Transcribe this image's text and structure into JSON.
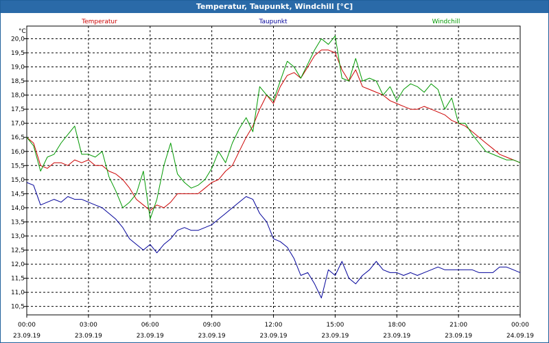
{
  "window": {
    "title": "Temperatur, Taupunkt, Windchill [°C]"
  },
  "chart_data": {
    "type": "line",
    "title": "Temperatur, Taupunkt, Windchill [°C]",
    "y_unit": "°C",
    "ylim": [
      10.2,
      20.45
    ],
    "yticks": [
      10.5,
      11.0,
      11.5,
      12.0,
      12.5,
      13.0,
      13.5,
      14.0,
      14.5,
      15.0,
      15.5,
      16.0,
      16.5,
      17.0,
      17.5,
      18.0,
      18.5,
      19.0,
      19.5,
      20.0
    ],
    "ytick_labels": [
      "10,5",
      "11,0",
      "11,5",
      "12,0",
      "12,5",
      "13,0",
      "13,5",
      "14,0",
      "14,5",
      "15,0",
      "15,5",
      "16,0",
      "16,5",
      "17,0",
      "17,5",
      "18,0",
      "18,5",
      "19,0",
      "19,5",
      "20,0"
    ],
    "xlim": [
      0,
      24
    ],
    "xticks": [
      0,
      3,
      6,
      9,
      12,
      15,
      18,
      21,
      24
    ],
    "xtick_labels": [
      [
        "00:00",
        "23.09.19"
      ],
      [
        "03:00",
        "23.09.19"
      ],
      [
        "06:00",
        "23.09.19"
      ],
      [
        "09:00",
        "23.09.19"
      ],
      [
        "12:00",
        "23.09.19"
      ],
      [
        "15:00",
        "23.09.19"
      ],
      [
        "18:00",
        "23.09.19"
      ],
      [
        "21:00",
        "23.09.19"
      ],
      [
        "00:00",
        "24.09.19"
      ]
    ],
    "grid": true,
    "legend_placement": "top",
    "series": [
      {
        "name": "Temperatur",
        "color": "#cc0000",
        "x": [
          0,
          0.33,
          0.67,
          1,
          1.33,
          1.67,
          2,
          2.33,
          2.67,
          3,
          3.33,
          3.67,
          4,
          4.33,
          4.67,
          5,
          5.33,
          5.67,
          6,
          6.33,
          6.67,
          7,
          7.33,
          7.67,
          8,
          8.33,
          8.67,
          9,
          9.33,
          9.67,
          10,
          10.33,
          10.67,
          11,
          11.33,
          11.67,
          12,
          12.33,
          12.67,
          13,
          13.33,
          13.67,
          14,
          14.33,
          14.67,
          15,
          15.33,
          15.67,
          16,
          16.33,
          16.67,
          17,
          17.33,
          17.67,
          18,
          18.33,
          18.67,
          19,
          19.33,
          19.67,
          20,
          20.33,
          20.67,
          21,
          21.33,
          21.67,
          22,
          22.33,
          22.67,
          23,
          23.33,
          23.67,
          24
        ],
        "y": [
          16.5,
          16.3,
          15.5,
          15.4,
          15.6,
          15.6,
          15.5,
          15.7,
          15.6,
          15.7,
          15.5,
          15.5,
          15.3,
          15.2,
          15.0,
          14.7,
          14.3,
          14.1,
          13.9,
          14.1,
          14.0,
          14.2,
          14.5,
          14.5,
          14.5,
          14.5,
          14.7,
          14.9,
          15.0,
          15.3,
          15.5,
          16.0,
          16.5,
          16.9,
          17.5,
          18.0,
          17.7,
          18.3,
          18.7,
          18.8,
          18.6,
          19.0,
          19.4,
          19.6,
          19.6,
          19.5,
          18.9,
          18.5,
          18.9,
          18.3,
          18.2,
          18.1,
          18.0,
          17.8,
          17.7,
          17.6,
          17.5,
          17.5,
          17.6,
          17.5,
          17.4,
          17.3,
          17.1,
          17.0,
          16.9,
          16.7,
          16.5,
          16.3,
          16.1,
          15.9,
          15.8,
          15.7,
          15.6
        ]
      },
      {
        "name": "Taupunkt",
        "color": "#000099",
        "x": [
          0,
          0.33,
          0.67,
          1,
          1.33,
          1.67,
          2,
          2.33,
          2.67,
          3,
          3.33,
          3.67,
          4,
          4.33,
          4.67,
          5,
          5.33,
          5.67,
          6,
          6.33,
          6.67,
          7,
          7.33,
          7.67,
          8,
          8.33,
          8.67,
          9,
          9.33,
          9.67,
          10,
          10.33,
          10.67,
          11,
          11.33,
          11.67,
          12,
          12.33,
          12.67,
          13,
          13.33,
          13.67,
          14,
          14.33,
          14.67,
          15,
          15.33,
          15.67,
          16,
          16.33,
          16.67,
          17,
          17.33,
          17.67,
          18,
          18.33,
          18.67,
          19,
          19.33,
          19.67,
          20,
          20.33,
          20.67,
          21,
          21.33,
          21.67,
          22,
          22.33,
          22.67,
          23,
          23.33,
          23.67,
          24
        ],
        "y": [
          14.9,
          14.8,
          14.1,
          14.2,
          14.3,
          14.2,
          14.4,
          14.3,
          14.3,
          14.2,
          14.1,
          14.0,
          13.8,
          13.6,
          13.3,
          12.9,
          12.7,
          12.5,
          12.7,
          12.4,
          12.7,
          12.9,
          13.2,
          13.3,
          13.2,
          13.2,
          13.3,
          13.4,
          13.6,
          13.8,
          14.0,
          14.2,
          14.4,
          14.3,
          13.8,
          13.5,
          12.9,
          12.8,
          12.6,
          12.2,
          11.6,
          11.7,
          11.3,
          10.8,
          11.8,
          11.6,
          12.1,
          11.5,
          11.3,
          11.6,
          11.8,
          12.1,
          11.8,
          11.7,
          11.7,
          11.6,
          11.7,
          11.6,
          11.7,
          11.8,
          11.9,
          11.8,
          11.8,
          11.8,
          11.8,
          11.8,
          11.7,
          11.7,
          11.7,
          11.9,
          11.9,
          11.8,
          11.7
        ]
      },
      {
        "name": "Windchill",
        "color": "#009900",
        "x": [
          0,
          0.33,
          0.67,
          1,
          1.33,
          1.67,
          2,
          2.33,
          2.67,
          3,
          3.33,
          3.67,
          4,
          4.33,
          4.67,
          5,
          5.33,
          5.67,
          6,
          6.33,
          6.67,
          7,
          7.33,
          7.67,
          8,
          8.33,
          8.67,
          9,
          9.33,
          9.67,
          10,
          10.33,
          10.67,
          11,
          11.33,
          11.67,
          12,
          12.33,
          12.67,
          13,
          13.33,
          13.67,
          14,
          14.33,
          14.67,
          15,
          15.33,
          15.67,
          16,
          16.33,
          16.67,
          17,
          17.33,
          17.67,
          18,
          18.33,
          18.67,
          19,
          19.33,
          19.67,
          20,
          20.33,
          20.67,
          21,
          21.33,
          21.67,
          22,
          22.33,
          22.67,
          23,
          23.33,
          23.67,
          24
        ],
        "y": [
          16.5,
          16.2,
          15.3,
          15.8,
          15.9,
          16.3,
          16.6,
          16.9,
          15.9,
          15.9,
          15.8,
          16.0,
          15.1,
          14.6,
          14.0,
          14.2,
          14.5,
          15.3,
          13.6,
          14.3,
          15.5,
          16.3,
          15.2,
          14.9,
          14.7,
          14.8,
          15.0,
          15.4,
          16.0,
          15.6,
          16.3,
          16.8,
          17.2,
          16.7,
          18.3,
          18.0,
          17.8,
          18.5,
          19.2,
          19.0,
          18.6,
          19.1,
          19.6,
          20.0,
          19.8,
          20.1,
          18.6,
          18.5,
          19.3,
          18.5,
          18.6,
          18.5,
          18.0,
          18.3,
          17.8,
          18.2,
          18.4,
          18.3,
          18.1,
          18.4,
          18.2,
          17.5,
          17.9,
          17.0,
          17.0,
          16.6,
          16.3,
          16.0,
          15.9,
          15.8,
          15.7,
          15.7,
          15.6
        ]
      }
    ]
  }
}
